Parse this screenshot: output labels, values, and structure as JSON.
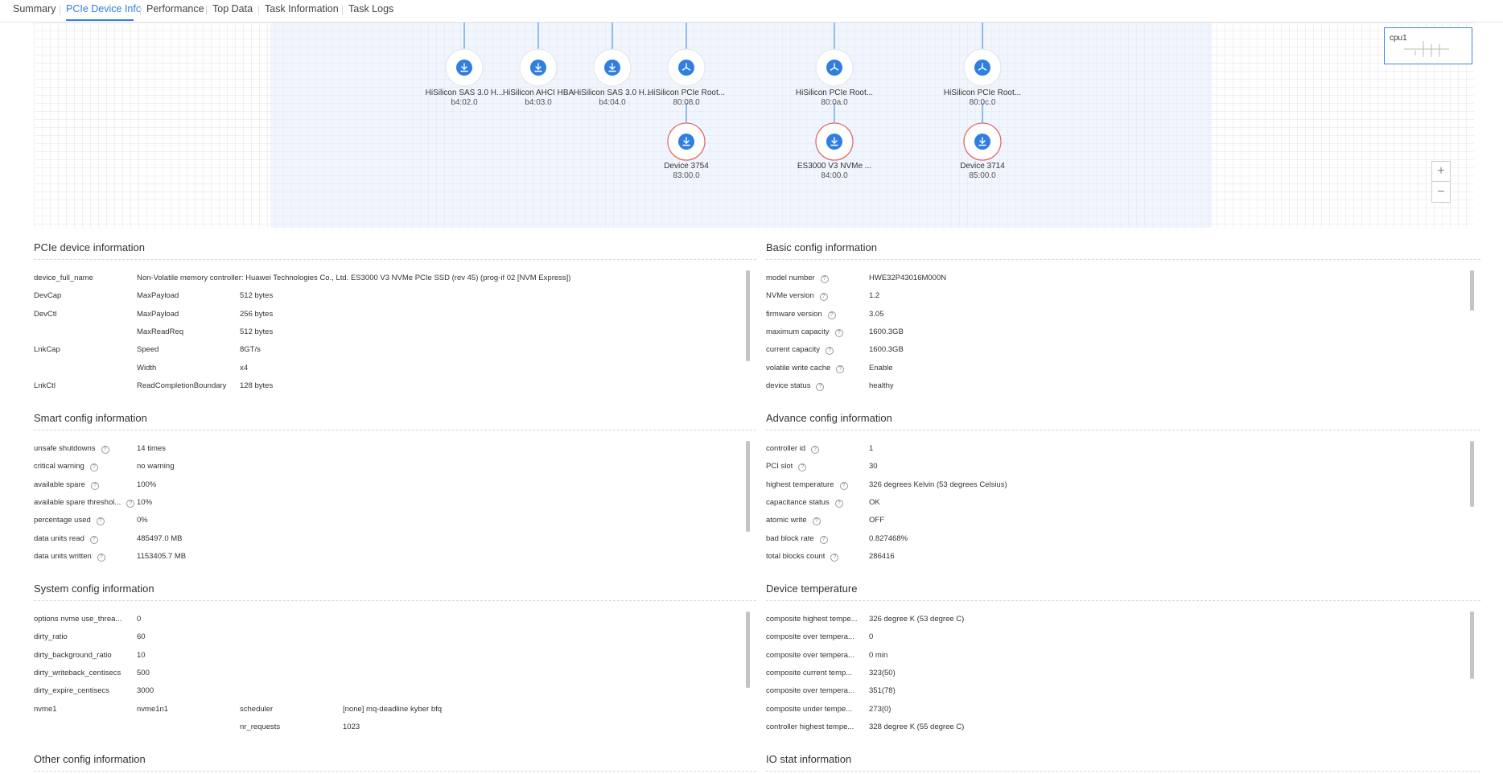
{
  "tabs": [
    {
      "label": "Summary",
      "active": false
    },
    {
      "label": "PCIe Device Info",
      "active": true
    },
    {
      "label": "Performance",
      "active": false
    },
    {
      "label": "Top Data",
      "active": false
    },
    {
      "label": "Task Information",
      "active": false
    },
    {
      "label": "Task Logs",
      "active": false
    }
  ],
  "topology": {
    "nodes": [
      {
        "name": "HiSilicon SAS 3.0 H...",
        "id": "b4:02.0",
        "icon": "download-icon",
        "selected": false
      },
      {
        "name": "HiSilicon AHCI HBA",
        "id": "b4:03.0",
        "icon": "download-icon",
        "selected": false
      },
      {
        "name": "HiSilicon SAS 3.0 H...",
        "id": "b4:04.0",
        "icon": "download-icon",
        "selected": false
      },
      {
        "name": "HiSilicon PCIe Root...",
        "id": "80:08.0",
        "icon": "hub-icon",
        "selected": false
      },
      {
        "name": "Device 3754",
        "id": "83:00.0",
        "icon": "download-icon",
        "selected": true
      },
      {
        "name": "HiSilicon PCIe Root...",
        "id": "80:0a.0",
        "icon": "hub-icon",
        "selected": false
      },
      {
        "name": "ES3000 V3 NVMe ...",
        "id": "84:00.0",
        "icon": "download-icon",
        "selected": true
      },
      {
        "name": "HiSilicon PCIe Root...",
        "id": "80:0c.0",
        "icon": "hub-icon",
        "selected": false
      },
      {
        "name": "Device 3714",
        "id": "85:00.0",
        "icon": "download-icon",
        "selected": true
      }
    ],
    "minimap_label": "cpu1",
    "zoom_in": "+",
    "zoom_out": "−",
    "colors": {
      "node_icon": "#2f7ee0",
      "selected_ring": "#e06a6a",
      "link": "#8fbcf0",
      "accent": "#2f7ee0"
    }
  },
  "pcie": {
    "title": "PCIe device information",
    "rows": [
      [
        "device_full_name",
        "Non-Volatile memory controller: Huawei Technologies Co., Ltd. ES3000 V3 NVMe PCIe SSD (rev 45) (prog-if 02 [NVM Express])",
        ""
      ],
      [
        "DevCap",
        "MaxPayload",
        "512 bytes"
      ],
      [
        "DevCtl",
        "MaxPayload",
        "256 bytes"
      ],
      [
        "",
        "MaxReadReq",
        "512 bytes"
      ],
      [
        "LnkCap",
        "Speed",
        "8GT/s"
      ],
      [
        "",
        "Width",
        "x4"
      ],
      [
        "LnkCtl",
        "ReadCompletionBoundary",
        "128 bytes"
      ]
    ]
  },
  "basic": {
    "title": "Basic config information",
    "rows": [
      [
        "model number",
        "HWE32P43016M000N"
      ],
      [
        "NVMe version",
        "1.2"
      ],
      [
        "firmware version",
        "3.05"
      ],
      [
        "maximum capacity",
        "1600.3GB"
      ],
      [
        "current capacity",
        "1600.3GB"
      ],
      [
        "volatile write cache",
        "Enable"
      ],
      [
        "device status",
        "healthy"
      ]
    ]
  },
  "smart": {
    "title": "Smart config information",
    "rows": [
      [
        "unsafe shutdowns",
        "14 times"
      ],
      [
        "critical warning",
        "no warning"
      ],
      [
        "available spare",
        "100%"
      ],
      [
        "available spare threshol...",
        "10%"
      ],
      [
        "percentage used",
        "0%"
      ],
      [
        "data units read",
        "485497.0 MB"
      ],
      [
        "data units written",
        "1153405.7 MB"
      ]
    ]
  },
  "advance": {
    "title": "Advance config information",
    "rows": [
      [
        "controller id",
        "1"
      ],
      [
        "PCI slot",
        "30"
      ],
      [
        "highest temperature",
        "326 degrees Kelvin (53 degrees Celsius)"
      ],
      [
        "capacitance status",
        "OK"
      ],
      [
        "atomic write",
        "OFF"
      ],
      [
        "bad block rate",
        "0.827468%"
      ],
      [
        "total blocks count",
        "286416"
      ]
    ]
  },
  "system": {
    "title": "System config information",
    "rows": [
      [
        "options nvme use_threa...",
        "0",
        "",
        ""
      ],
      [
        "dirty_ratio",
        "60",
        "",
        ""
      ],
      [
        "dirty_background_ratio",
        "10",
        "",
        ""
      ],
      [
        "dirty_writeback_centisecs",
        "500",
        "",
        ""
      ],
      [
        "dirty_expire_centisecs",
        "3000",
        "",
        ""
      ],
      [
        "nvme1",
        "nvme1n1",
        "scheduler",
        "[none] mq-deadline kyber bfq"
      ],
      [
        "",
        "",
        "nr_requests",
        "1023"
      ]
    ]
  },
  "temperature": {
    "title": "Device temperature",
    "rows": [
      [
        "composite highest tempe...",
        "326 degree K (53 degree C)"
      ],
      [
        "composite over tempera...",
        "0"
      ],
      [
        "composite over tempera...",
        "0 min"
      ],
      [
        "composite current temp...",
        "323(50)"
      ],
      [
        "composite over tempera...",
        "351(78)"
      ],
      [
        "composite under tempe...",
        "273(0)"
      ],
      [
        "controller highest tempe...",
        "328 degree K (55 degree C)"
      ]
    ]
  },
  "other": {
    "title": "Other config information"
  },
  "iostat": {
    "title": "IO stat information"
  }
}
